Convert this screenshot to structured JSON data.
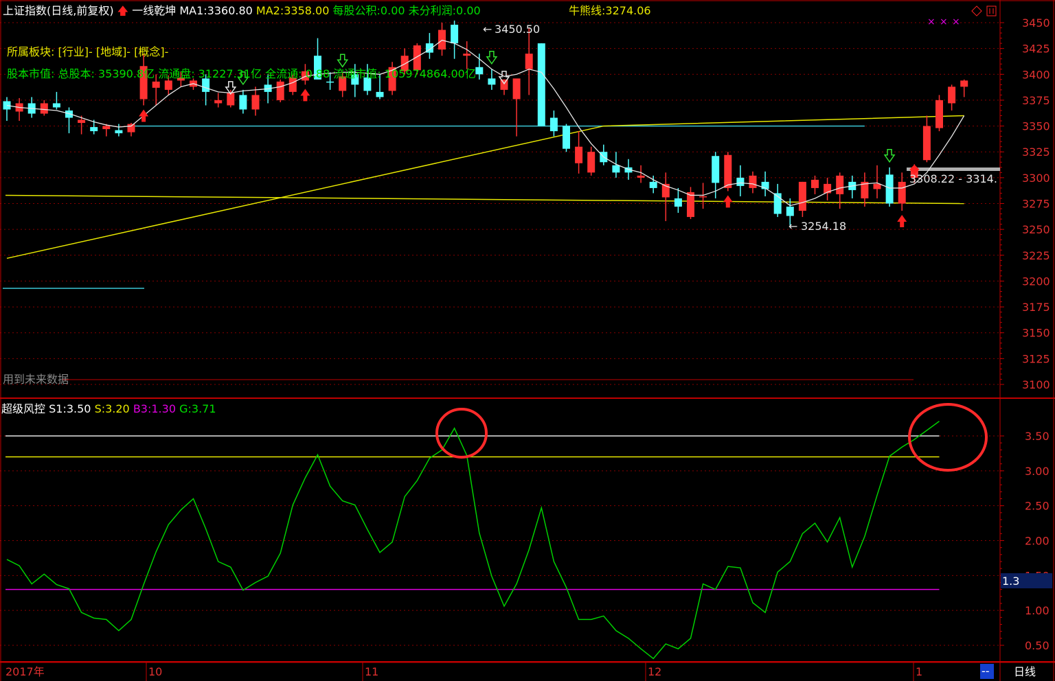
{
  "header": {
    "index_name": "上证指数(日线,前复权)",
    "arrow_glyph": "🡅",
    "indicator_name": "一线乾坤",
    "ma1_label": "MA1:",
    "ma1_value": "3360.80",
    "ma2_label": "MA2:",
    "ma2_value": "3358.00",
    "eps_label": "每股公积:",
    "eps_value": "0.00",
    "undist_label": "未分利润:",
    "undist_value": "0.00",
    "bull_bear_label": "牛熊线:",
    "bull_bear_value": "3274.06"
  },
  "info": {
    "sector_line": "所属板块: [行业]- [地域]- [概念]-",
    "cap_line": "股本市值: 总股本: 35390.8亿 流通盘: 31227.31亿 全流通: 0.88 流通市值: 105974864.00亿"
  },
  "future_data_label": "用到未来数据",
  "subchart": {
    "name": "超级风控",
    "s1_label": "S1:",
    "s1_value": "3.50",
    "s_label": "S:",
    "s_value": "3.20",
    "b3_label": "B3:",
    "b3_value": "1.30",
    "g_label": "G:",
    "g_value": "3.71",
    "current_marker": "1.3"
  },
  "annotations": {
    "high": "3450.50",
    "low": "3254.18",
    "range": "3308.22 - 3314."
  },
  "bottom": {
    "year_label": "2017年",
    "months": [
      "10",
      "11",
      "12",
      "1"
    ],
    "period_label": "日线",
    "button_label": "--"
  },
  "colors": {
    "up": "#ff3232",
    "down": "#54ffff",
    "ma_white": "#e6e6e6",
    "ma_yellow": "#e8e800",
    "grid": "#8b0000",
    "indicator": "#00d000"
  },
  "chart_data": [
    {
      "type": "candlestick",
      "ylim": [
        3095,
        3460
      ],
      "yticks": [
        3100,
        3125,
        3150,
        3175,
        3200,
        3225,
        3250,
        3275,
        3300,
        3325,
        3350,
        3375,
        3400,
        3425,
        3450
      ],
      "x_month_labels": [
        "10",
        "11",
        "12",
        "1"
      ],
      "candles": [
        [
          3374,
          3378,
          3355,
          3366
        ],
        [
          3364,
          3377,
          3355,
          3372
        ],
        [
          3372,
          3378,
          3358,
          3362
        ],
        [
          3362,
          3375,
          3360,
          3372
        ],
        [
          3372,
          3383,
          3366,
          3368
        ],
        [
          3365,
          3368,
          3343,
          3358
        ],
        [
          3353,
          3360,
          3342,
          3356
        ],
        [
          3349,
          3356,
          3342,
          3345
        ],
        [
          3347,
          3352,
          3340,
          3350
        ],
        [
          3346,
          3352,
          3340,
          3343
        ],
        [
          3344,
          3353,
          3340,
          3352
        ],
        [
          3376,
          3420,
          3370,
          3408
        ],
        [
          3387,
          3400,
          3370,
          3393
        ],
        [
          3385,
          3399,
          3380,
          3394
        ],
        [
          3394,
          3403,
          3388,
          3397
        ],
        [
          3388,
          3396,
          3385,
          3394
        ],
        [
          3396,
          3400,
          3370,
          3383
        ],
        [
          3372,
          3382,
          3368,
          3375
        ],
        [
          3370,
          3385,
          3368,
          3382
        ],
        [
          3380,
          3385,
          3362,
          3366
        ],
        [
          3366,
          3388,
          3360,
          3380
        ],
        [
          3390,
          3400,
          3372,
          3383
        ],
        [
          3375,
          3395,
          3373,
          3393
        ],
        [
          3383,
          3400,
          3380,
          3397
        ],
        [
          3394,
          3410,
          3390,
          3403
        ],
        [
          3418,
          3435,
          3400,
          3395
        ],
        [
          3393,
          3402,
          3385,
          3392
        ],
        [
          3384,
          3402,
          3378,
          3398
        ],
        [
          3400,
          3410,
          3378,
          3390
        ],
        [
          3397,
          3410,
          3380,
          3384
        ],
        [
          3383,
          3400,
          3376,
          3378
        ],
        [
          3384,
          3412,
          3380,
          3407
        ],
        [
          3403,
          3425,
          3400,
          3418
        ],
        [
          3404,
          3430,
          3400,
          3428
        ],
        [
          3430,
          3440,
          3415,
          3421
        ],
        [
          3424,
          3450,
          3418,
          3443
        ],
        [
          3448,
          3452,
          3415,
          3430
        ],
        [
          3418,
          3432,
          3405,
          3420
        ],
        [
          3407,
          3420,
          3395,
          3400
        ],
        [
          3396,
          3405,
          3385,
          3390
        ],
        [
          3385,
          3395,
          3380,
          3395
        ],
        [
          3376,
          3392,
          3340,
          3396
        ],
        [
          3405,
          3445,
          3380,
          3420
        ],
        [
          3430,
          3430,
          3350,
          3350
        ],
        [
          3358,
          3365,
          3340,
          3345
        ],
        [
          3350,
          3352,
          3325,
          3328
        ],
        [
          3314,
          3345,
          3304,
          3330
        ],
        [
          3305,
          3330,
          3302,
          3325
        ],
        [
          3325,
          3332,
          3312,
          3315
        ],
        [
          3312,
          3325,
          3300,
          3305
        ],
        [
          3310,
          3318,
          3298,
          3305
        ],
        [
          3300,
          3312,
          3295,
          3302
        ],
        [
          3296,
          3302,
          3285,
          3290
        ],
        [
          3281,
          3305,
          3258,
          3294
        ],
        [
          3280,
          3290,
          3266,
          3272
        ],
        [
          3262,
          3291,
          3260,
          3286
        ],
        [
          3281,
          3295,
          3270,
          3282
        ],
        [
          3321,
          3325,
          3280,
          3295
        ],
        [
          3290,
          3325,
          3287,
          3322
        ],
        [
          3300,
          3312,
          3282,
          3292
        ],
        [
          3290,
          3306,
          3285,
          3302
        ],
        [
          3296,
          3306,
          3282,
          3289
        ],
        [
          3285,
          3294,
          3262,
          3265
        ],
        [
          3272,
          3280,
          3254,
          3263
        ],
        [
          3268,
          3296,
          3262,
          3296
        ],
        [
          3290,
          3302,
          3284,
          3298
        ],
        [
          3285,
          3300,
          3278,
          3294
        ],
        [
          3284,
          3305,
          3270,
          3302
        ],
        [
          3296,
          3302,
          3280,
          3288
        ],
        [
          3280,
          3305,
          3272,
          3296
        ],
        [
          3289,
          3312,
          3280,
          3294
        ],
        [
          3303,
          3310,
          3272,
          3275
        ],
        [
          3275,
          3305,
          3268,
          3296
        ],
        [
          3300,
          3313,
          3295,
          3309
        ],
        [
          3317,
          3360,
          3315,
          3350
        ],
        [
          3348,
          3380,
          3345,
          3375
        ],
        [
          3372,
          3390,
          3365,
          3388
        ],
        [
          3388,
          3395,
          3378,
          3394
        ]
      ],
      "ma1_white": [
        3370,
        3368,
        3367,
        3366,
        3365,
        3362,
        3358,
        3354,
        3351,
        3349,
        3350,
        3360,
        3370,
        3380,
        3388,
        3391,
        3387,
        3383,
        3382,
        3384,
        3385,
        3386,
        3388,
        3392,
        3398,
        3400,
        3401,
        3402,
        3402,
        3401,
        3400,
        3404,
        3410,
        3417,
        3424,
        3433,
        3430,
        3424,
        3415,
        3405,
        3398,
        3400,
        3405,
        3402,
        3386,
        3368,
        3349,
        3333,
        3320,
        3313,
        3308,
        3305,
        3298,
        3292,
        3288,
        3283,
        3283,
        3287,
        3293,
        3295,
        3294,
        3290,
        3282,
        3273,
        3276,
        3280,
        3286,
        3290,
        3292,
        3294,
        3295,
        3290,
        3290,
        3294,
        3305,
        3322,
        3340,
        3360
      ],
      "ma2_yellow_trend": [
        [
          0,
          3222
        ],
        [
          48,
          3350
        ],
        [
          77,
          3360
        ]
      ],
      "bull_bear_line": [
        [
          0,
          3283
        ],
        [
          77,
          3275
        ]
      ],
      "hlines": [
        {
          "y": 3350,
          "from": 10,
          "to": 69
        },
        {
          "y": 3308.22,
          "from": 74,
          "to": 80
        },
        {
          "y": 3200,
          "from": 0,
          "to": 11
        }
      ],
      "marks": {
        "red_up_arrows": [
          11,
          24,
          58,
          72
        ],
        "green_down_arrows": [
          19,
          27,
          39,
          71
        ],
        "white_down_arrows": [
          18,
          40
        ]
      }
    },
    {
      "type": "line",
      "ylim": [
        0.32,
        3.98
      ],
      "yticks": [
        0.5,
        1.0,
        1.5,
        2.0,
        2.5,
        3.0,
        3.5
      ],
      "series": [
        {
          "name": "S1",
          "constant": 3.5
        },
        {
          "name": "S",
          "constant": 3.2
        },
        {
          "name": "B3",
          "constant": 1.3
        },
        {
          "name": "G",
          "values": [
            1.73,
            1.64,
            1.38,
            1.52,
            1.37,
            1.31,
            0.97,
            0.89,
            0.87,
            0.71,
            0.87,
            1.37,
            1.84,
            2.23,
            2.44,
            2.6,
            2.17,
            1.7,
            1.62,
            1.29,
            1.4,
            1.49,
            1.82,
            2.51,
            2.9,
            3.23,
            2.78,
            2.57,
            2.51,
            2.16,
            1.83,
            1.98,
            2.63,
            2.86,
            3.18,
            3.3,
            3.61,
            3.22,
            2.11,
            1.49,
            1.06,
            1.38,
            1.87,
            2.47,
            1.7,
            1.33,
            0.87,
            0.87,
            0.92,
            0.71,
            0.6,
            0.45,
            0.31,
            0.52,
            0.45,
            0.6,
            1.38,
            1.3,
            1.63,
            1.61,
            1.11,
            0.97,
            1.55,
            1.7,
            2.1,
            2.25,
            1.98,
            2.33,
            1.62,
            2.06,
            2.65,
            3.21,
            3.34,
            3.45,
            3.58,
            3.71
          ]
        }
      ]
    }
  ]
}
